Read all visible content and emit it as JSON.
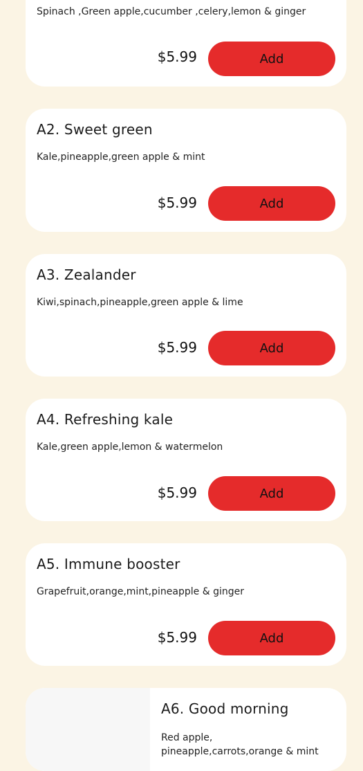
{
  "items": [
    {
      "title": "",
      "description": "Spinach ,Green apple,cucumber ,celery,lemon & ginger",
      "price": "$5.99",
      "add_label": "Add"
    },
    {
      "title": "A2. Sweet green",
      "description": "Kale,pineapple,green apple & mint",
      "price": "$5.99",
      "add_label": "Add"
    },
    {
      "title": "A3. Zealander",
      "description": "Kiwi,spinach,pineapple,green apple & lime",
      "price": "$5.99",
      "add_label": "Add"
    },
    {
      "title": "A4. Refreshing kale",
      "description": "Kale,green apple,lemon & watermelon",
      "price": "$5.99",
      "add_label": "Add"
    },
    {
      "title": "A5. Immune booster",
      "description": "Grapefruit,orange,mint,pineapple & ginger",
      "price": "$5.99",
      "add_label": "Add"
    },
    {
      "title": "A6. Good morning",
      "description": "Red apple, pineapple,carrots,orange & mint"
    }
  ],
  "colors": {
    "background": "#fbf4e4",
    "card": "#ffffff",
    "accent": "#e52b2b"
  }
}
